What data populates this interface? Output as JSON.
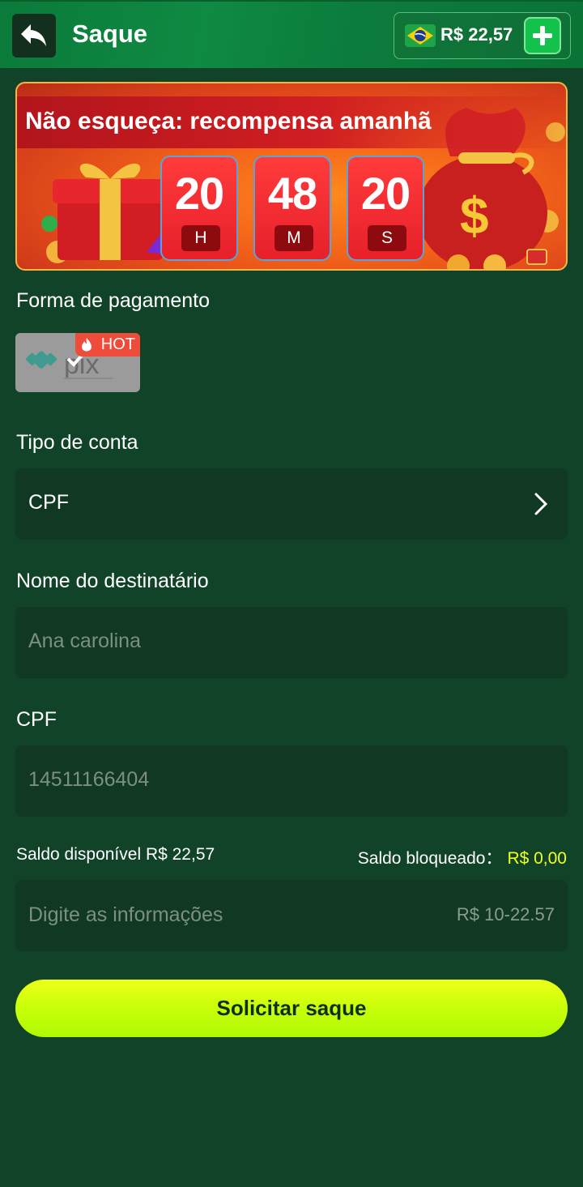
{
  "header": {
    "title": "Saque",
    "balance": "R$ 22,57"
  },
  "banner": {
    "title": "Não esqueça: recompensa amanhã",
    "timer": [
      {
        "value": "20",
        "unit": "H"
      },
      {
        "value": "48",
        "unit": "M"
      },
      {
        "value": "20",
        "unit": "S"
      }
    ]
  },
  "payment": {
    "label": "Forma de pagamento",
    "badge": "HOT"
  },
  "account_type": {
    "label": "Tipo de conta",
    "value": "CPF"
  },
  "recipient": {
    "label": "Nome do destinatário",
    "placeholder": "Ana carolina"
  },
  "cpf": {
    "label": "CPF",
    "placeholder": "14511166404"
  },
  "balances": {
    "available": "Saldo disponível R$ 22,57",
    "locked_label": "Saldo bloqueado：",
    "locked_value": "R$ 0,00"
  },
  "amount": {
    "placeholder": "Digite as informações",
    "range": "R$ 10-22.57"
  },
  "submit_label": "Solicitar saque",
  "colors": {
    "background": "#114328",
    "header": "#0f8a43",
    "button": "#d9ff10",
    "locked": "#f3ff1c"
  }
}
